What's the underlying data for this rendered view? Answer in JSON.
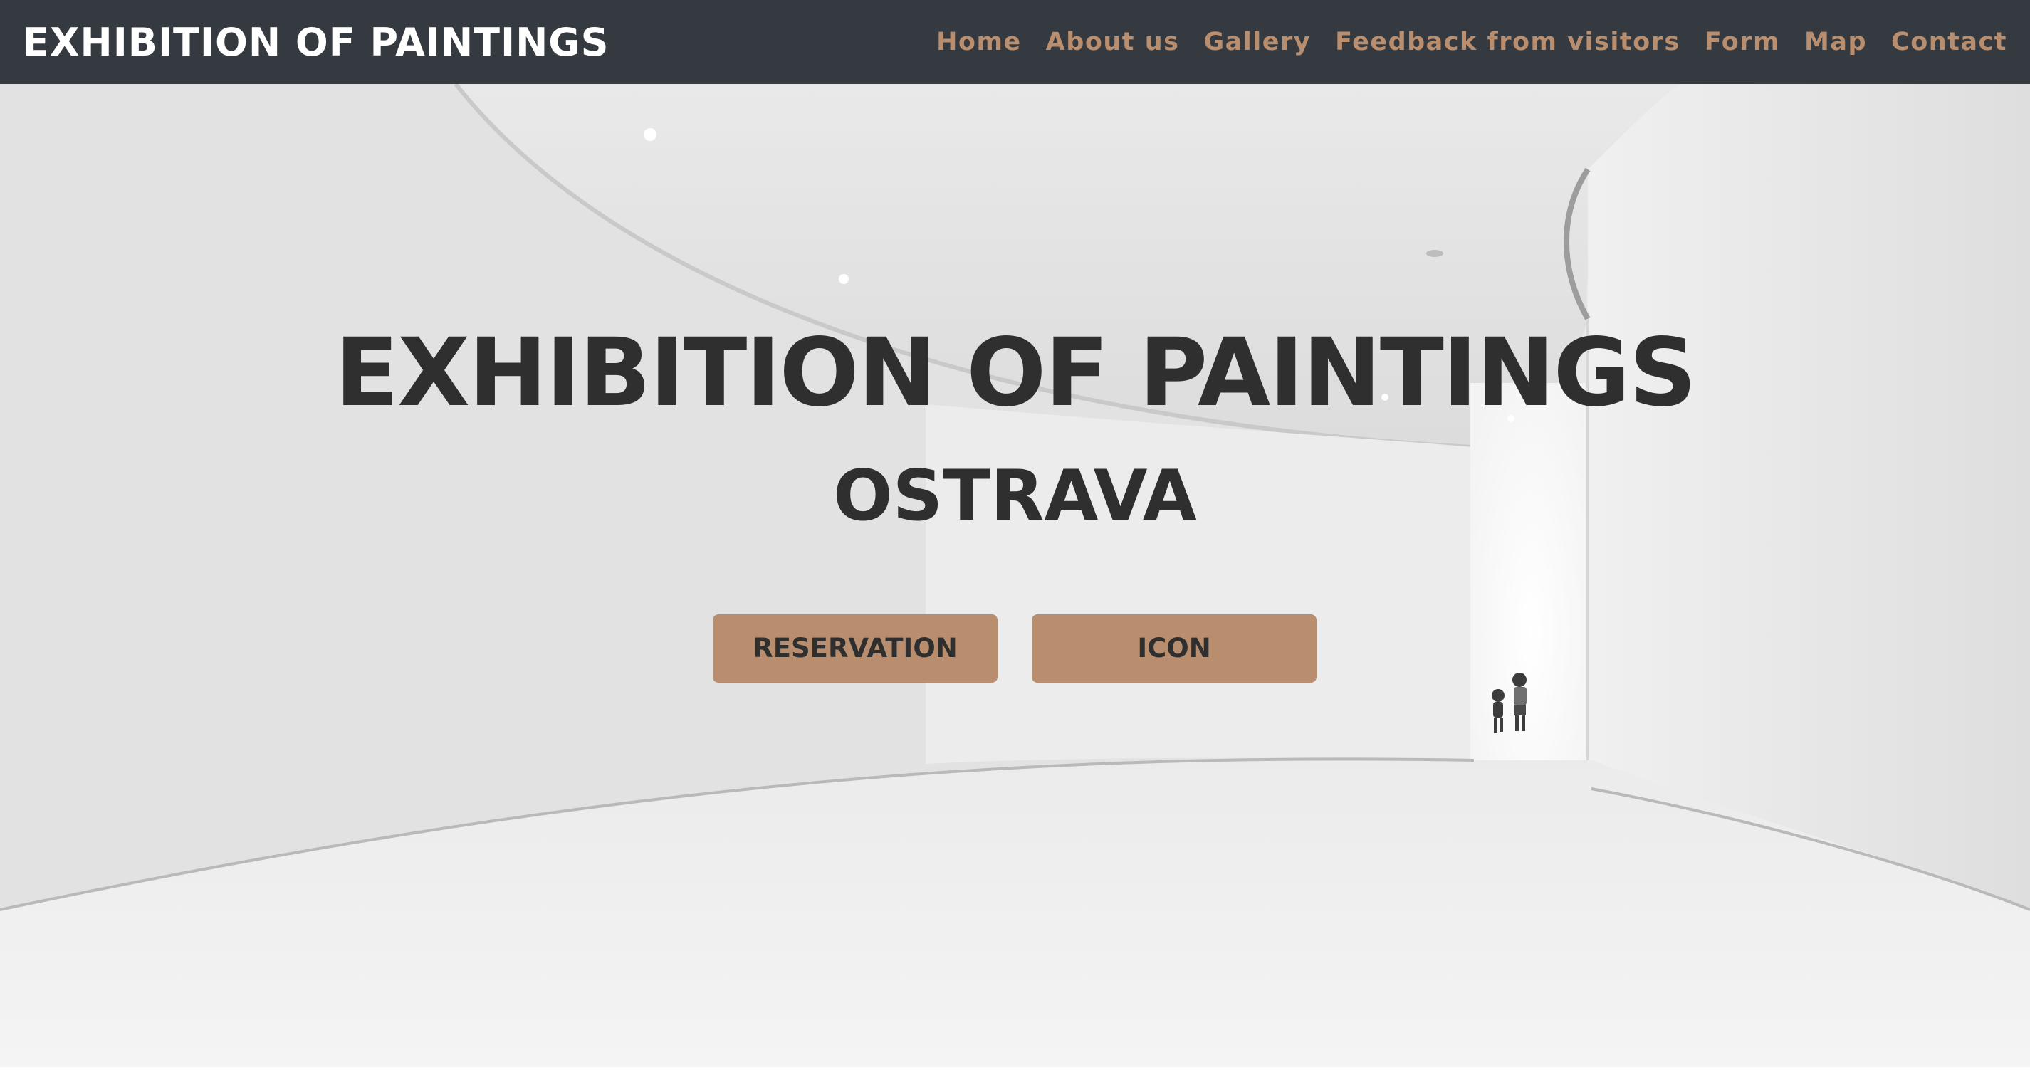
{
  "navbar": {
    "brand": "EXHIBITION OF PAINTINGS",
    "links": [
      {
        "label": "Home"
      },
      {
        "label": "About us"
      },
      {
        "label": "Gallery"
      },
      {
        "label": "Feedback from visitors"
      },
      {
        "label": "Form"
      },
      {
        "label": "Map"
      },
      {
        "label": "Contact"
      }
    ]
  },
  "hero": {
    "title": "EXHIBITION OF PAINTINGS",
    "subtitle": "OSTRAVA",
    "buttons": {
      "reservation": "RESERVATION",
      "icon": "ICON"
    }
  },
  "colors": {
    "navbar_bg": "#343a40",
    "brand_text": "#ffffff",
    "accent": "#b98e6f",
    "hero_text": "#2f2f2f"
  }
}
